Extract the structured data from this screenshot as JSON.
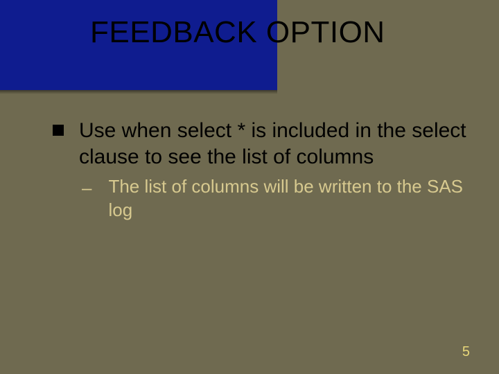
{
  "slide": {
    "title": "FEEDBACK OPTION",
    "bullets": [
      {
        "text": "Use when select * is included in the select clause to see the list of columns",
        "sub": [
          {
            "text": "The list of columns will be written to the SAS log"
          }
        ]
      }
    ],
    "page_number": "5"
  }
}
